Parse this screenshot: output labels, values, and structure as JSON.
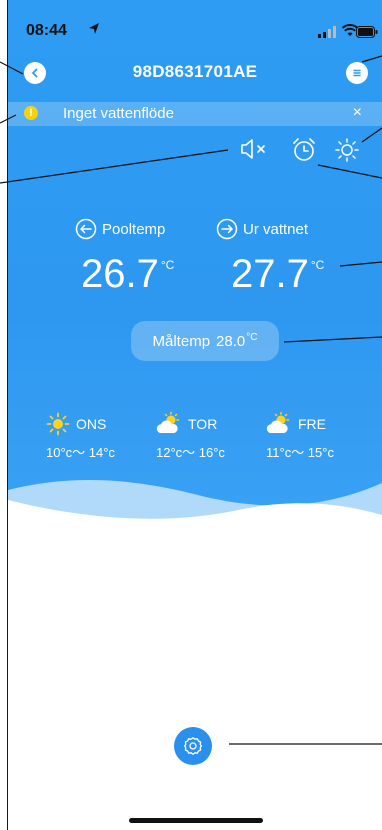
{
  "status_bar": {
    "time": "08:44"
  },
  "header": {
    "title": "98D8631701AE"
  },
  "alert": {
    "text": "Inget vattenflöde",
    "close": "×"
  },
  "temps": {
    "pool_label": "Pooltemp",
    "pool_value": "26.7",
    "outlet_label": "Ur vattnet",
    "outlet_value": "27.7",
    "unit": "°C"
  },
  "measure": {
    "label": "Måltemp",
    "value": "28.0",
    "unit": "°C"
  },
  "forecast": [
    {
      "day": "ONS",
      "range": "10°c～ 14°c",
      "icon": "sun-icon"
    },
    {
      "day": "TOR",
      "range": "12°c～ 16°c",
      "icon": "partly-cloudy-icon"
    },
    {
      "day": "FRE",
      "range": "11°c～ 15°c",
      "icon": "partly-cloudy-icon"
    }
  ],
  "colors": {
    "primary": "#2e9cf2",
    "alert_icon": "#f5d20e",
    "settings_button": "#2a90ee"
  }
}
